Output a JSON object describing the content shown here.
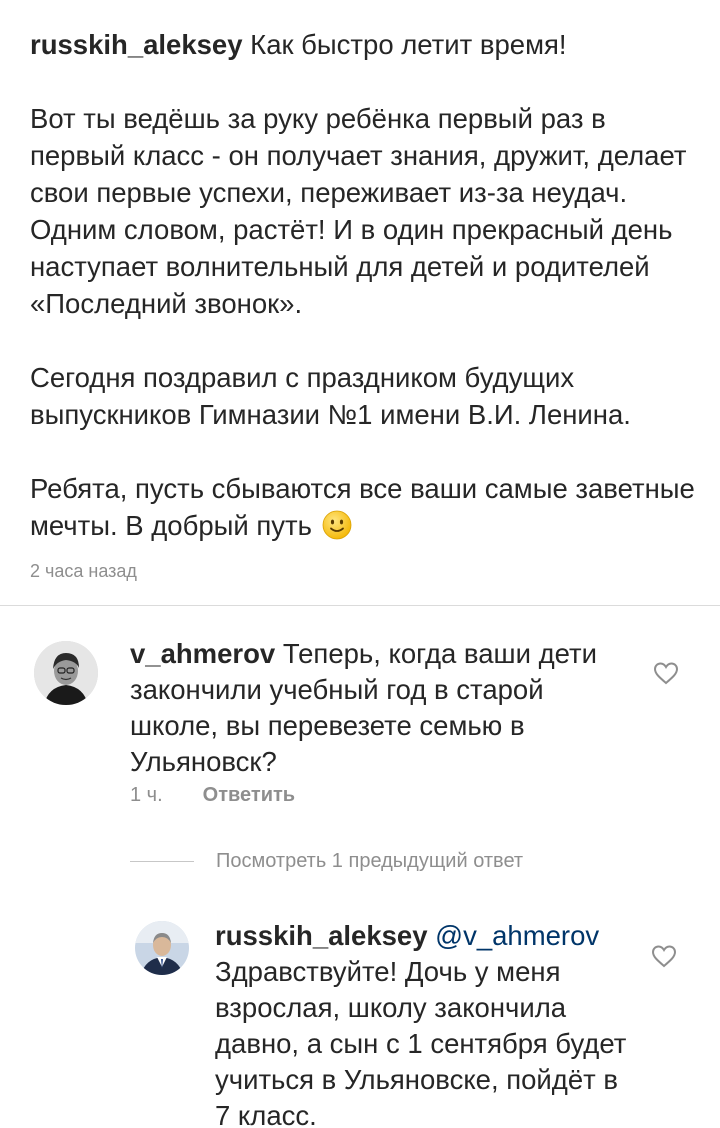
{
  "post": {
    "username": "russkih_aleksey",
    "caption_line1": "Как быстро летит время!",
    "caption_para2": "Вот ты ведёшь за руку ребёнка первый раз в первый класс - он получает знания, дружит, делает свои первые успехи, переживает из-за неудач. Одним словом, растёт! И в один прекрасный день наступает волнительный для детей и родителей «Последний звонок».",
    "caption_para3": "Сегодня поздравил с праздником будущих выпускников Гимназии №1 имени В.И. Ленина.",
    "caption_para4": "Ребята, пусть сбываются все ваши самые заветные мечты. В добрый путь",
    "emoji": "slightly-smiling-face-icon",
    "time": "2 часа назад"
  },
  "comments": [
    {
      "username": "v_ahmerov",
      "text": "Теперь, когда ваши дети закончили учебный год в старой школе, вы перевезете семью в Ульяновск?",
      "time": "1 ч.",
      "reply_label": "Ответить"
    }
  ],
  "view_replies_label": "Посмотреть 1 предыдущий ответ",
  "replies": [
    {
      "username": "russkih_aleksey",
      "mention": "@v_ahmerov",
      "text": "Здравствуйте! Дочь у меня взрослая, школу закончила давно, а сын с 1 сентября будет учиться в Ульяновске, пойдёт в 7 класс."
    }
  ],
  "colors": {
    "text": "#262626",
    "muted": "#8e8e8e",
    "mention": "#003569",
    "divider": "#dbdbdb"
  }
}
